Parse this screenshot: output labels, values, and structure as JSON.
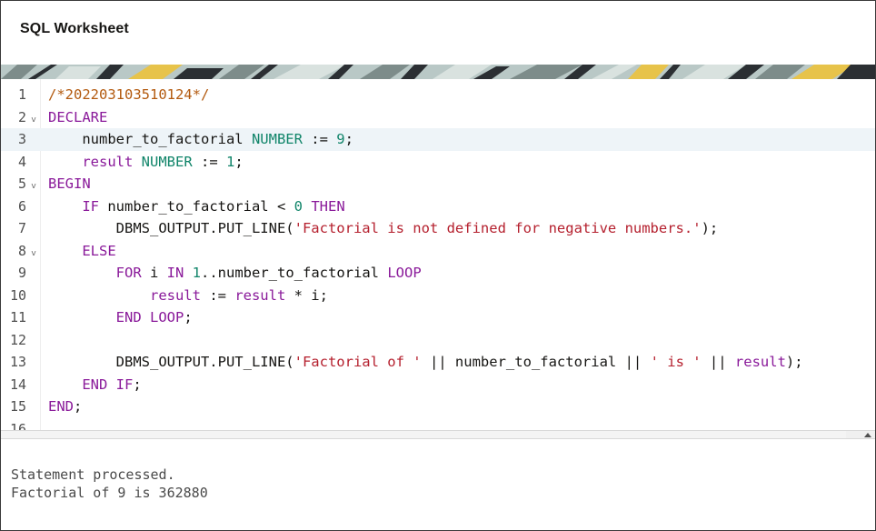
{
  "window": {
    "title": "SQL Worksheet"
  },
  "banner": {
    "icon": "decorative-pattern",
    "colors": [
      "#b9c8c6",
      "#2b2f33",
      "#e7c34a",
      "#7d8c8a",
      "#d9e2df"
    ]
  },
  "editor": {
    "active_line": 3,
    "lines": [
      {
        "n": "1",
        "fold": "",
        "segments": [
          {
            "t": "/*202203103510124*/",
            "c": "cm"
          }
        ]
      },
      {
        "n": "2",
        "fold": "v",
        "segments": [
          {
            "t": "DECLARE",
            "c": "kw"
          }
        ]
      },
      {
        "n": "3",
        "fold": "",
        "segments": [
          {
            "t": "    number_to_factorial ",
            "c": "id"
          },
          {
            "t": "NUMBER",
            "c": "ty"
          },
          {
            "t": " := ",
            "c": "id"
          },
          {
            "t": "9",
            "c": "num"
          },
          {
            "t": ";",
            "c": "id"
          }
        ]
      },
      {
        "n": "4",
        "fold": "",
        "segments": [
          {
            "t": "    ",
            "c": "id"
          },
          {
            "t": "result",
            "c": "kw"
          },
          {
            "t": " ",
            "c": "id"
          },
          {
            "t": "NUMBER",
            "c": "ty"
          },
          {
            "t": " := ",
            "c": "id"
          },
          {
            "t": "1",
            "c": "num"
          },
          {
            "t": ";",
            "c": "id"
          }
        ]
      },
      {
        "n": "5",
        "fold": "v",
        "segments": [
          {
            "t": "BEGIN",
            "c": "kw"
          }
        ]
      },
      {
        "n": "6",
        "fold": "",
        "segments": [
          {
            "t": "    ",
            "c": "id"
          },
          {
            "t": "IF",
            "c": "kw"
          },
          {
            "t": " number_to_factorial < ",
            "c": "id"
          },
          {
            "t": "0",
            "c": "num"
          },
          {
            "t": " ",
            "c": "id"
          },
          {
            "t": "THEN",
            "c": "kw"
          }
        ]
      },
      {
        "n": "7",
        "fold": "",
        "segments": [
          {
            "t": "        DBMS_OUTPUT.PUT_LINE(",
            "c": "id"
          },
          {
            "t": "'Factorial is not defined for negative numbers.'",
            "c": "str"
          },
          {
            "t": ");",
            "c": "id"
          }
        ]
      },
      {
        "n": "8",
        "fold": "v",
        "segments": [
          {
            "t": "    ",
            "c": "id"
          },
          {
            "t": "ELSE",
            "c": "kw"
          }
        ]
      },
      {
        "n": "9",
        "fold": "",
        "segments": [
          {
            "t": "        ",
            "c": "id"
          },
          {
            "t": "FOR",
            "c": "kw"
          },
          {
            "t": " i ",
            "c": "id"
          },
          {
            "t": "IN",
            "c": "kw"
          },
          {
            "t": " ",
            "c": "id"
          },
          {
            "t": "1",
            "c": "num"
          },
          {
            "t": "..number_to_factorial ",
            "c": "id"
          },
          {
            "t": "LOOP",
            "c": "kw"
          }
        ]
      },
      {
        "n": "10",
        "fold": "",
        "segments": [
          {
            "t": "            ",
            "c": "id"
          },
          {
            "t": "result",
            "c": "kw"
          },
          {
            "t": " := ",
            "c": "id"
          },
          {
            "t": "result",
            "c": "kw"
          },
          {
            "t": " * i;",
            "c": "id"
          }
        ]
      },
      {
        "n": "11",
        "fold": "",
        "segments": [
          {
            "t": "        ",
            "c": "id"
          },
          {
            "t": "END",
            "c": "kw"
          },
          {
            "t": " ",
            "c": "id"
          },
          {
            "t": "LOOP",
            "c": "kw"
          },
          {
            "t": ";",
            "c": "id"
          }
        ]
      },
      {
        "n": "12",
        "fold": "",
        "segments": [
          {
            "t": "",
            "c": "id"
          }
        ]
      },
      {
        "n": "13",
        "fold": "",
        "segments": [
          {
            "t": "        DBMS_OUTPUT.PUT_LINE(",
            "c": "id"
          },
          {
            "t": "'Factorial of '",
            "c": "str"
          },
          {
            "t": " || number_to_factorial || ",
            "c": "id"
          },
          {
            "t": "' is '",
            "c": "str"
          },
          {
            "t": " || ",
            "c": "id"
          },
          {
            "t": "result",
            "c": "kw"
          },
          {
            "t": ");",
            "c": "id"
          }
        ]
      },
      {
        "n": "14",
        "fold": "",
        "segments": [
          {
            "t": "    ",
            "c": "id"
          },
          {
            "t": "END",
            "c": "kw"
          },
          {
            "t": " ",
            "c": "id"
          },
          {
            "t": "IF",
            "c": "kw"
          },
          {
            "t": ";",
            "c": "id"
          }
        ]
      },
      {
        "n": "15",
        "fold": "",
        "segments": [
          {
            "t": "END",
            "c": "kw"
          },
          {
            "t": ";",
            "c": "id"
          }
        ]
      },
      {
        "n": "16",
        "fold": "",
        "segments": [
          {
            "t": "",
            "c": "id"
          }
        ]
      }
    ]
  },
  "scrollbar": {
    "icon": "scroll-up-arrow-icon"
  },
  "output": {
    "lines": [
      "Statement processed.",
      "Factorial of 9 is 362880"
    ]
  }
}
